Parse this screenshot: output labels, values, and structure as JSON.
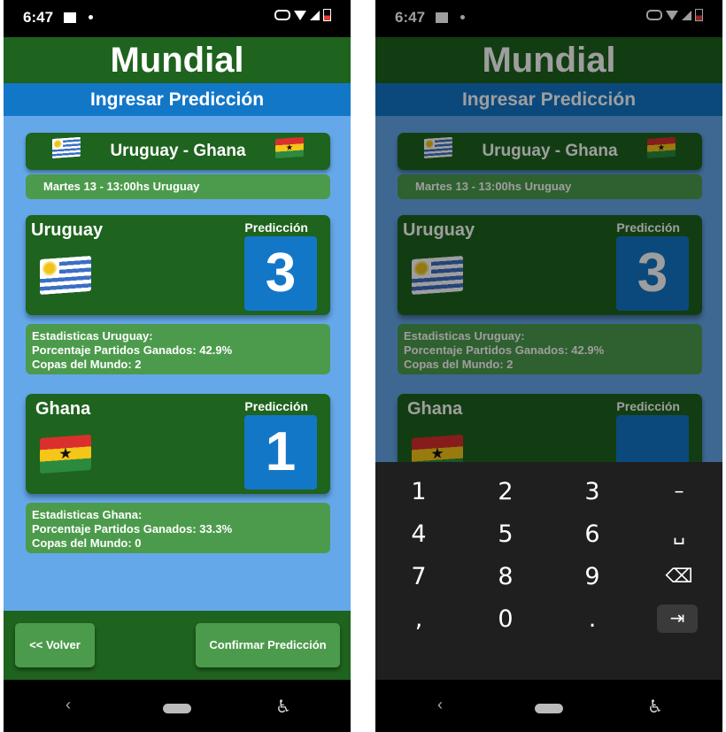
{
  "status": {
    "time": "6:47"
  },
  "app": {
    "title": "Mundial",
    "subtitle": "Ingresar Predicción",
    "match": {
      "title": "Uruguay - Ghana",
      "date": "Martes 13 - 13:00hs Uruguay"
    },
    "teams": [
      {
        "name": "Uruguay",
        "prediction_label": "Predicción",
        "prediction_value": "3",
        "stats": [
          "Estadisticas Uruguay:",
          "Porcentaje Partidos Ganados: 42.9%",
          "Copas del Mundo: 2"
        ]
      },
      {
        "name": "Ghana",
        "prediction_label": "Predicción",
        "prediction_value": "1",
        "stats": [
          "Estadisticas Ghana:",
          "Porcentaje Partidos Ganados: 33.3%",
          "Copas del Mundo: 0"
        ]
      }
    ],
    "buttons": {
      "back": "<< Volver",
      "confirm": "Confirmar Predicción"
    }
  },
  "keyboard": {
    "keys": [
      "1",
      "2",
      "3",
      "–",
      "4",
      "5",
      "6",
      "␣",
      "7",
      "8",
      "9",
      "⌫",
      ",",
      "0",
      ".",
      "⇥"
    ]
  },
  "colors": {
    "title_bar": "#1e631e",
    "subtitle_bar": "#1377c8",
    "background": "#64a8ea",
    "card": "#1e631e",
    "stats": "#4c9b4c",
    "prediction_box": "#1377c8"
  },
  "icons": [
    "image-icon",
    "vpn-key-icon",
    "wifi-icon",
    "signal-icon",
    "battery-icon",
    "back-nav-icon",
    "home-nav-icon",
    "accessibility-icon"
  ]
}
